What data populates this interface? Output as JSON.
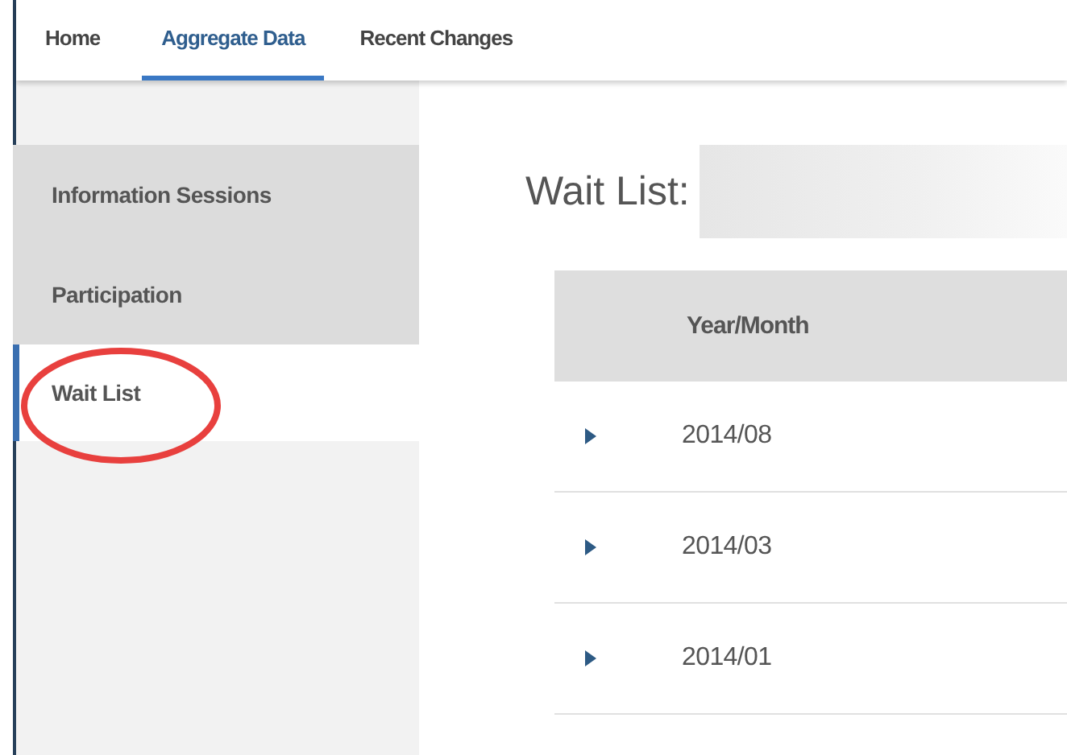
{
  "tabs": [
    {
      "label": "Home",
      "selected": false
    },
    {
      "label": "Aggregate Data",
      "selected": true
    },
    {
      "label": "Recent Changes",
      "selected": false
    }
  ],
  "sidebar": {
    "items": [
      {
        "label": "Information Sessions",
        "selected": false
      },
      {
        "label": "Participation",
        "selected": false
      },
      {
        "label": "Wait List",
        "selected": true,
        "circled": true
      }
    ]
  },
  "page_title": "Wait List:",
  "table": {
    "columns": [
      "Year/Month"
    ],
    "rows": [
      {
        "cells": [
          "2014/08"
        ],
        "expanded": false
      },
      {
        "cells": [
          "2014/03"
        ],
        "expanded": false
      },
      {
        "cells": [
          "2014/01"
        ],
        "expanded": false
      }
    ]
  }
}
